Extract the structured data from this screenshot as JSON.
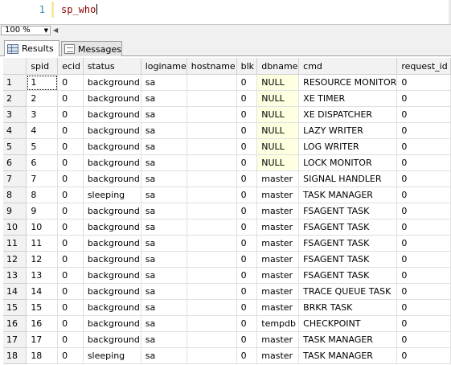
{
  "editor": {
    "line_number": "1",
    "query": "sp_who"
  },
  "zoom": {
    "value": "100 %",
    "arrow": "▼",
    "scroll_left": "◀"
  },
  "tabs": [
    {
      "label": "Results",
      "active": true
    },
    {
      "label": "Messages",
      "active": false
    }
  ],
  "grid": {
    "columns": [
      "spid",
      "ecid",
      "status",
      "loginame",
      "hostname",
      "blk",
      "dbname",
      "cmd",
      "request_id"
    ],
    "rows": [
      [
        "1",
        "1",
        "0",
        "background",
        "sa",
        "",
        "0",
        "NULL",
        "RESOURCE MONITOR",
        "0"
      ],
      [
        "2",
        "2",
        "0",
        "background",
        "sa",
        "",
        "0",
        "NULL",
        "XE TIMER",
        "0"
      ],
      [
        "3",
        "3",
        "0",
        "background",
        "sa",
        "",
        "0",
        "NULL",
        "XE DISPATCHER",
        "0"
      ],
      [
        "4",
        "4",
        "0",
        "background",
        "sa",
        "",
        "0",
        "NULL",
        "LAZY WRITER",
        "0"
      ],
      [
        "5",
        "5",
        "0",
        "background",
        "sa",
        "",
        "0",
        "NULL",
        "LOG WRITER",
        "0"
      ],
      [
        "6",
        "6",
        "0",
        "background",
        "sa",
        "",
        "0",
        "NULL",
        "LOCK MONITOR",
        "0"
      ],
      [
        "7",
        "7",
        "0",
        "background",
        "sa",
        "",
        "0",
        "master",
        "SIGNAL HANDLER",
        "0"
      ],
      [
        "8",
        "8",
        "0",
        "sleeping",
        "sa",
        "",
        "0",
        "master",
        "TASK MANAGER",
        "0"
      ],
      [
        "9",
        "9",
        "0",
        "background",
        "sa",
        "",
        "0",
        "master",
        "FSAGENT TASK",
        "0"
      ],
      [
        "10",
        "10",
        "0",
        "background",
        "sa",
        "",
        "0",
        "master",
        "FSAGENT TASK",
        "0"
      ],
      [
        "11",
        "11",
        "0",
        "background",
        "sa",
        "",
        "0",
        "master",
        "FSAGENT TASK",
        "0"
      ],
      [
        "12",
        "12",
        "0",
        "background",
        "sa",
        "",
        "0",
        "master",
        "FSAGENT TASK",
        "0"
      ],
      [
        "13",
        "13",
        "0",
        "background",
        "sa",
        "",
        "0",
        "master",
        "FSAGENT TASK",
        "0"
      ],
      [
        "14",
        "14",
        "0",
        "background",
        "sa",
        "",
        "0",
        "master",
        "TRACE QUEUE TASK",
        "0"
      ],
      [
        "15",
        "15",
        "0",
        "background",
        "sa",
        "",
        "0",
        "master",
        "BRKR TASK",
        "0"
      ],
      [
        "16",
        "16",
        "0",
        "background",
        "sa",
        "",
        "0",
        "tempdb",
        "CHECKPOINT",
        "0"
      ],
      [
        "17",
        "17",
        "0",
        "background",
        "sa",
        "",
        "0",
        "master",
        "TASK MANAGER",
        "0"
      ],
      [
        "18",
        "18",
        "0",
        "sleeping",
        "sa",
        "",
        "0",
        "master",
        "TASK MANAGER",
        "0"
      ]
    ]
  },
  "colors": {
    "null_cell": "#ffffe1",
    "header_bg": "#f2f2f2",
    "keyword": "#8b0000",
    "line_number": "#2b91af"
  }
}
